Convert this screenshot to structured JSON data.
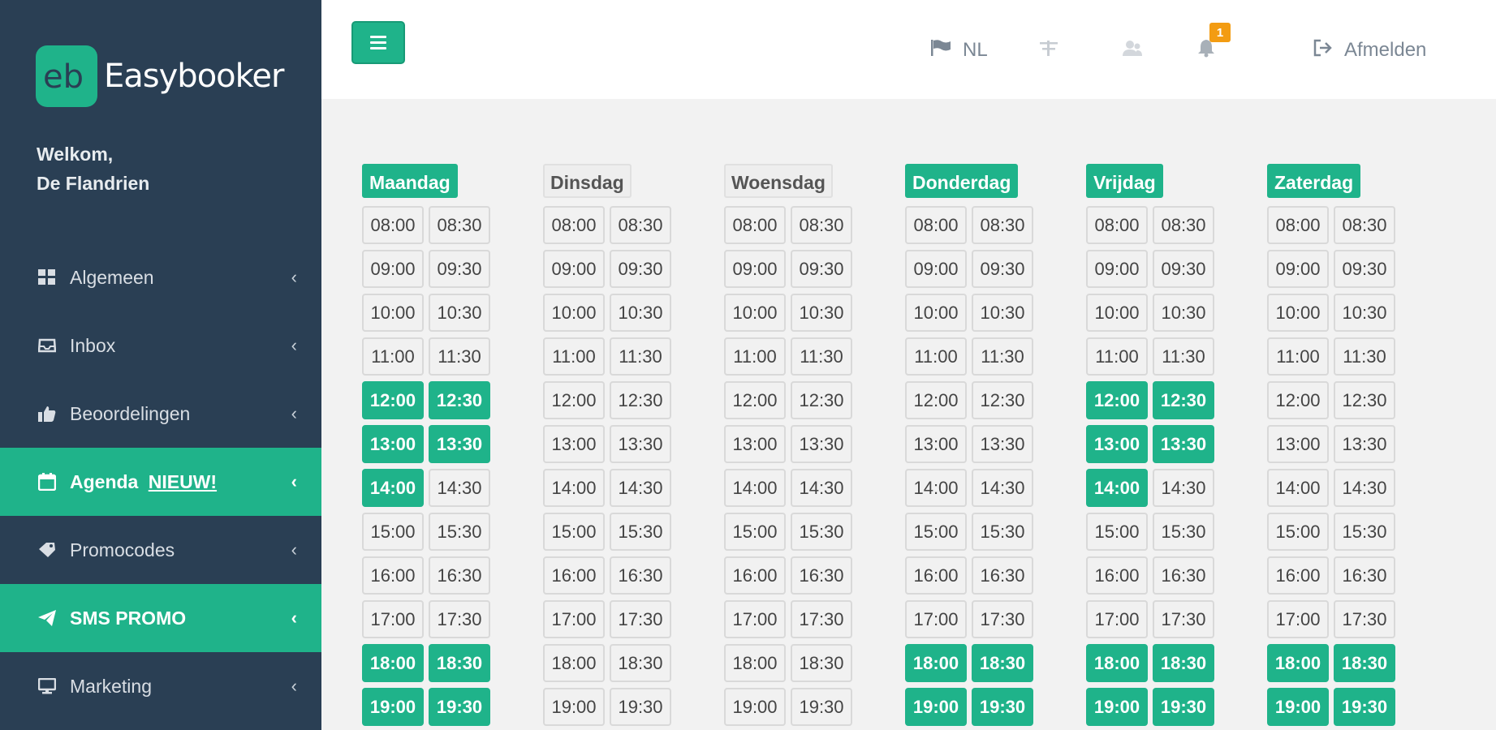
{
  "brand": {
    "name": "Easybooker",
    "logo_text": "eb"
  },
  "welcome": {
    "line1": "Welkom,",
    "line2": "De Flandrien"
  },
  "sidebar": {
    "items": [
      {
        "label": "Algemeen",
        "icon": "dashboard-icon",
        "active": false
      },
      {
        "label": "Inbox",
        "icon": "inbox-icon",
        "active": false
      },
      {
        "label": "Beoordelingen",
        "icon": "thumbs-up-icon",
        "active": false
      },
      {
        "label": "Agenda",
        "badge": "NIEUW!",
        "icon": "calendar-icon",
        "active": true
      },
      {
        "label": "Promocodes",
        "icon": "tag-icon",
        "active": false
      },
      {
        "label": "SMS PROMO",
        "icon": "paper-plane-icon",
        "active": true
      },
      {
        "label": "Marketing",
        "icon": "monitor-icon",
        "active": false
      }
    ]
  },
  "topbar": {
    "lang": "NL",
    "notifications": "1",
    "logout": "Afmelden"
  },
  "colors": {
    "accent": "#1fb38a",
    "sidebar": "#2a3f54",
    "badge": "#f39c12"
  },
  "agenda": {
    "days": [
      {
        "name": "Maandag",
        "active": true,
        "slots": [
          {
            "t": "08:00",
            "on": false
          },
          {
            "t": "08:30",
            "on": false
          },
          {
            "t": "09:00",
            "on": false
          },
          {
            "t": "09:30",
            "on": false
          },
          {
            "t": "10:00",
            "on": false
          },
          {
            "t": "10:30",
            "on": false
          },
          {
            "t": "11:00",
            "on": false
          },
          {
            "t": "11:30",
            "on": false
          },
          {
            "t": "12:00",
            "on": true
          },
          {
            "t": "12:30",
            "on": true
          },
          {
            "t": "13:00",
            "on": true
          },
          {
            "t": "13:30",
            "on": true
          },
          {
            "t": "14:00",
            "on": true
          },
          {
            "t": "14:30",
            "on": false
          },
          {
            "t": "15:00",
            "on": false
          },
          {
            "t": "15:30",
            "on": false
          },
          {
            "t": "16:00",
            "on": false
          },
          {
            "t": "16:30",
            "on": false
          },
          {
            "t": "17:00",
            "on": false
          },
          {
            "t": "17:30",
            "on": false
          },
          {
            "t": "18:00",
            "on": true
          },
          {
            "t": "18:30",
            "on": true
          },
          {
            "t": "19:00",
            "on": true
          },
          {
            "t": "19:30",
            "on": true
          }
        ]
      },
      {
        "name": "Dinsdag",
        "active": false,
        "slots": [
          {
            "t": "08:00",
            "on": false
          },
          {
            "t": "08:30",
            "on": false
          },
          {
            "t": "09:00",
            "on": false
          },
          {
            "t": "09:30",
            "on": false
          },
          {
            "t": "10:00",
            "on": false
          },
          {
            "t": "10:30",
            "on": false
          },
          {
            "t": "11:00",
            "on": false
          },
          {
            "t": "11:30",
            "on": false
          },
          {
            "t": "12:00",
            "on": false
          },
          {
            "t": "12:30",
            "on": false
          },
          {
            "t": "13:00",
            "on": false
          },
          {
            "t": "13:30",
            "on": false
          },
          {
            "t": "14:00",
            "on": false
          },
          {
            "t": "14:30",
            "on": false
          },
          {
            "t": "15:00",
            "on": false
          },
          {
            "t": "15:30",
            "on": false
          },
          {
            "t": "16:00",
            "on": false
          },
          {
            "t": "16:30",
            "on": false
          },
          {
            "t": "17:00",
            "on": false
          },
          {
            "t": "17:30",
            "on": false
          },
          {
            "t": "18:00",
            "on": false
          },
          {
            "t": "18:30",
            "on": false
          },
          {
            "t": "19:00",
            "on": false
          },
          {
            "t": "19:30",
            "on": false
          }
        ]
      },
      {
        "name": "Woensdag",
        "active": false,
        "slots": [
          {
            "t": "08:00",
            "on": false
          },
          {
            "t": "08:30",
            "on": false
          },
          {
            "t": "09:00",
            "on": false
          },
          {
            "t": "09:30",
            "on": false
          },
          {
            "t": "10:00",
            "on": false
          },
          {
            "t": "10:30",
            "on": false
          },
          {
            "t": "11:00",
            "on": false
          },
          {
            "t": "11:30",
            "on": false
          },
          {
            "t": "12:00",
            "on": false
          },
          {
            "t": "12:30",
            "on": false
          },
          {
            "t": "13:00",
            "on": false
          },
          {
            "t": "13:30",
            "on": false
          },
          {
            "t": "14:00",
            "on": false
          },
          {
            "t": "14:30",
            "on": false
          },
          {
            "t": "15:00",
            "on": false
          },
          {
            "t": "15:30",
            "on": false
          },
          {
            "t": "16:00",
            "on": false
          },
          {
            "t": "16:30",
            "on": false
          },
          {
            "t": "17:00",
            "on": false
          },
          {
            "t": "17:30",
            "on": false
          },
          {
            "t": "18:00",
            "on": false
          },
          {
            "t": "18:30",
            "on": false
          },
          {
            "t": "19:00",
            "on": false
          },
          {
            "t": "19:30",
            "on": false
          }
        ]
      },
      {
        "name": "Donderdag",
        "active": true,
        "slots": [
          {
            "t": "08:00",
            "on": false
          },
          {
            "t": "08:30",
            "on": false
          },
          {
            "t": "09:00",
            "on": false
          },
          {
            "t": "09:30",
            "on": false
          },
          {
            "t": "10:00",
            "on": false
          },
          {
            "t": "10:30",
            "on": false
          },
          {
            "t": "11:00",
            "on": false
          },
          {
            "t": "11:30",
            "on": false
          },
          {
            "t": "12:00",
            "on": false
          },
          {
            "t": "12:30",
            "on": false
          },
          {
            "t": "13:00",
            "on": false
          },
          {
            "t": "13:30",
            "on": false
          },
          {
            "t": "14:00",
            "on": false
          },
          {
            "t": "14:30",
            "on": false
          },
          {
            "t": "15:00",
            "on": false
          },
          {
            "t": "15:30",
            "on": false
          },
          {
            "t": "16:00",
            "on": false
          },
          {
            "t": "16:30",
            "on": false
          },
          {
            "t": "17:00",
            "on": false
          },
          {
            "t": "17:30",
            "on": false
          },
          {
            "t": "18:00",
            "on": true
          },
          {
            "t": "18:30",
            "on": true
          },
          {
            "t": "19:00",
            "on": true
          },
          {
            "t": "19:30",
            "on": true
          }
        ]
      },
      {
        "name": "Vrijdag",
        "active": true,
        "slots": [
          {
            "t": "08:00",
            "on": false
          },
          {
            "t": "08:30",
            "on": false
          },
          {
            "t": "09:00",
            "on": false
          },
          {
            "t": "09:30",
            "on": false
          },
          {
            "t": "10:00",
            "on": false
          },
          {
            "t": "10:30",
            "on": false
          },
          {
            "t": "11:00",
            "on": false
          },
          {
            "t": "11:30",
            "on": false
          },
          {
            "t": "12:00",
            "on": true
          },
          {
            "t": "12:30",
            "on": true
          },
          {
            "t": "13:00",
            "on": true
          },
          {
            "t": "13:30",
            "on": true
          },
          {
            "t": "14:00",
            "on": true
          },
          {
            "t": "14:30",
            "on": false
          },
          {
            "t": "15:00",
            "on": false
          },
          {
            "t": "15:30",
            "on": false
          },
          {
            "t": "16:00",
            "on": false
          },
          {
            "t": "16:30",
            "on": false
          },
          {
            "t": "17:00",
            "on": false
          },
          {
            "t": "17:30",
            "on": false
          },
          {
            "t": "18:00",
            "on": true
          },
          {
            "t": "18:30",
            "on": true
          },
          {
            "t": "19:00",
            "on": true
          },
          {
            "t": "19:30",
            "on": true
          }
        ]
      },
      {
        "name": "Zaterdag",
        "active": true,
        "slots": [
          {
            "t": "08:00",
            "on": false
          },
          {
            "t": "08:30",
            "on": false
          },
          {
            "t": "09:00",
            "on": false
          },
          {
            "t": "09:30",
            "on": false
          },
          {
            "t": "10:00",
            "on": false
          },
          {
            "t": "10:30",
            "on": false
          },
          {
            "t": "11:00",
            "on": false
          },
          {
            "t": "11:30",
            "on": false
          },
          {
            "t": "12:00",
            "on": false
          },
          {
            "t": "12:30",
            "on": false
          },
          {
            "t": "13:00",
            "on": false
          },
          {
            "t": "13:30",
            "on": false
          },
          {
            "t": "14:00",
            "on": false
          },
          {
            "t": "14:30",
            "on": false
          },
          {
            "t": "15:00",
            "on": false
          },
          {
            "t": "15:30",
            "on": false
          },
          {
            "t": "16:00",
            "on": false
          },
          {
            "t": "16:30",
            "on": false
          },
          {
            "t": "17:00",
            "on": false
          },
          {
            "t": "17:30",
            "on": false
          },
          {
            "t": "18:00",
            "on": true
          },
          {
            "t": "18:30",
            "on": true
          },
          {
            "t": "19:00",
            "on": true
          },
          {
            "t": "19:30",
            "on": true
          }
        ]
      }
    ]
  }
}
